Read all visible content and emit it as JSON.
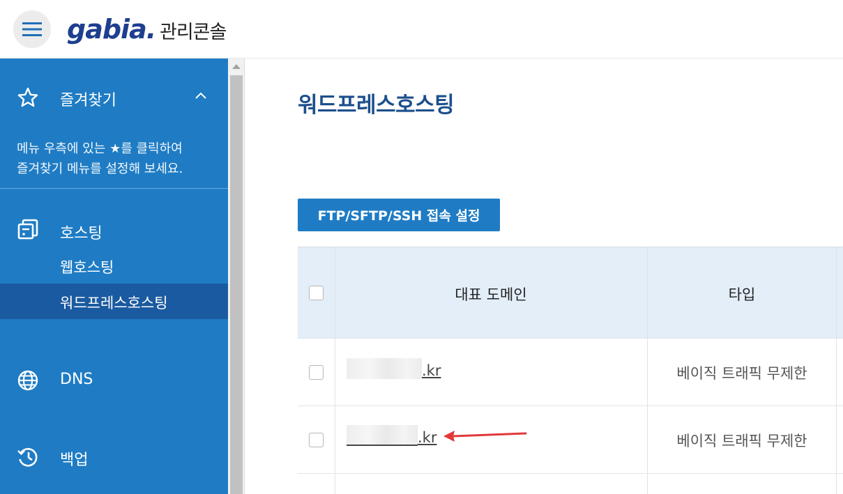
{
  "header": {
    "menu_icon": "hamburger-icon",
    "logo_text": "gabia.",
    "console_label": "관리콘솔"
  },
  "sidebar": {
    "favorites": {
      "icon": "star-icon",
      "label": "즐겨찾기",
      "toggle_icon": "chevron-up-icon",
      "hint_line1": "메뉴 우측에 있는 ★를 클릭하여",
      "hint_line2": "즐겨찾기 메뉴를 설정해 보세요."
    },
    "sections": [
      {
        "icon": "hosting-icon",
        "label": "호스팅",
        "items": [
          {
            "label": "웹호스팅",
            "active": false
          },
          {
            "label": "워드프레스호스팅",
            "active": true
          }
        ]
      },
      {
        "icon": "globe-icon",
        "label": "DNS"
      },
      {
        "icon": "history-icon",
        "label": "백업"
      }
    ]
  },
  "main": {
    "title": "워드프레스호스팅",
    "ftp_button_label": "FTP/SFTP/SSH 접속 설정",
    "table": {
      "columns": [
        "",
        "대표 도메인",
        "타입"
      ],
      "rows": [
        {
          "domain_suffix": ".kr",
          "type": "베이직 트래픽 무제한"
        },
        {
          "domain_suffix": ".kr",
          "type": "베이직 트래픽 무제한"
        }
      ]
    }
  },
  "colors": {
    "sidebar_bg": "#1f7cc4",
    "sidebar_active": "#1a5aa0",
    "accent": "#1f7cc4",
    "table_header_bg": "#e3eef8",
    "title_color": "#1c4f8c",
    "annotation_arrow": "#e2383b"
  }
}
